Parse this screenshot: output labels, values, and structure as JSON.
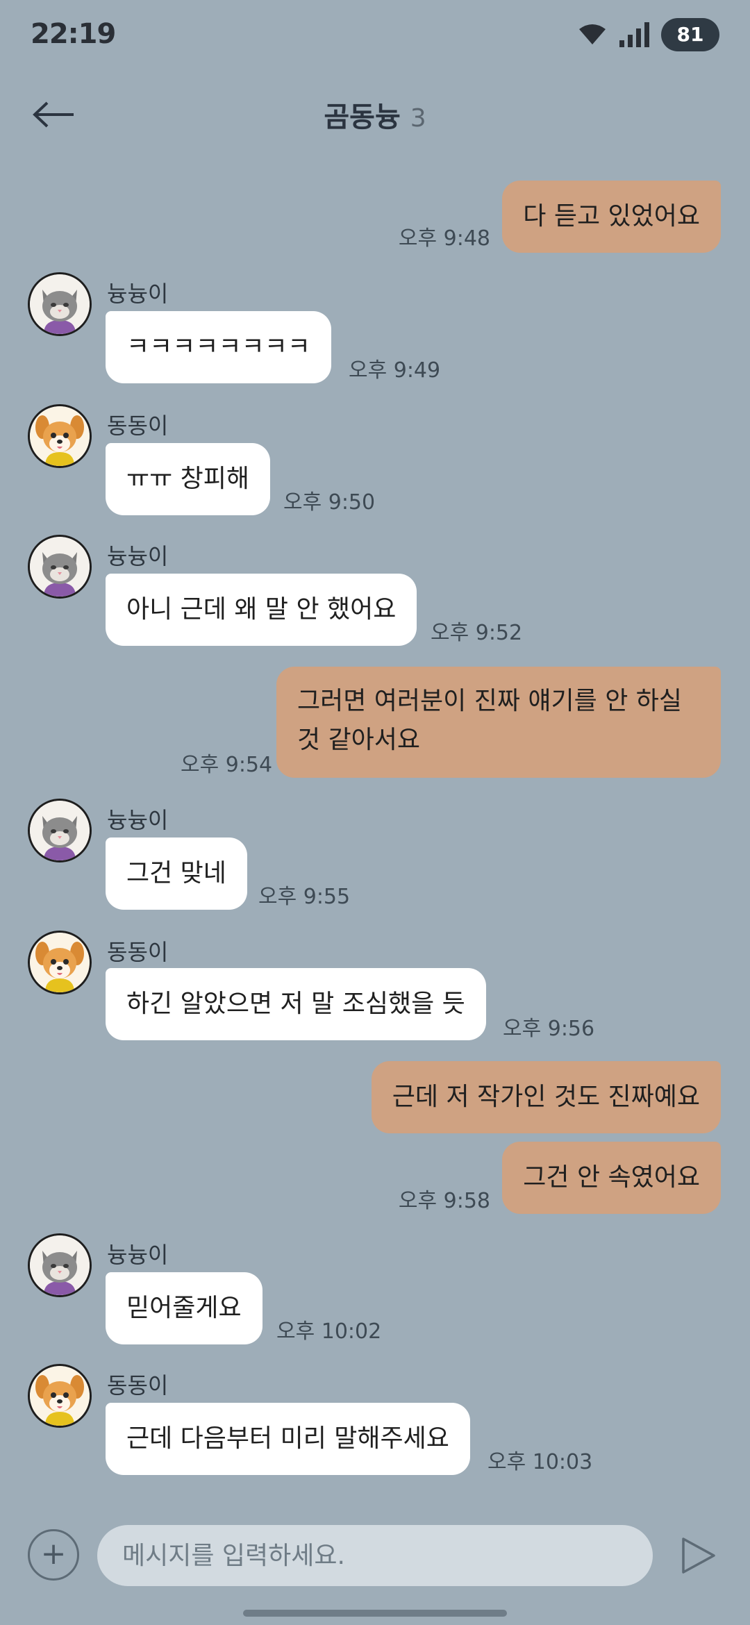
{
  "status": {
    "time": "22:19",
    "battery": "81"
  },
  "header": {
    "title": "곰동늉",
    "member_count": "3"
  },
  "messages": [
    {
      "type": "out",
      "text": "다 듣고 있었어요",
      "time": "오후 9:48"
    },
    {
      "type": "in",
      "sender": "늉늉이",
      "avatar": "cat",
      "text": "ㅋㅋㅋㅋㅋㅋㅋㅋ",
      "time": "오후 9:49"
    },
    {
      "type": "in",
      "sender": "동동이",
      "avatar": "dog",
      "text": "ㅠㅠ 창피해",
      "time": "오후 9:50"
    },
    {
      "type": "in",
      "sender": "늉늉이",
      "avatar": "cat",
      "text": "아니 근데 왜 말 안 했어요",
      "time": "오후 9:52"
    },
    {
      "type": "out",
      "text": "그러면 여러분이 진짜 얘기를 안 하실 것 같아서요",
      "time": "오후 9:54"
    },
    {
      "type": "in",
      "sender": "늉늉이",
      "avatar": "cat",
      "text": "그건 맞네",
      "time": "오후 9:55"
    },
    {
      "type": "in",
      "sender": "동동이",
      "avatar": "dog",
      "text": "하긴 알았으면 저 말 조심했을 듯",
      "time": "오후 9:56"
    },
    {
      "type": "out",
      "text": "근데 저 작가인 것도 진짜예요",
      "time": ""
    },
    {
      "type": "out",
      "text": "그건 안 속였어요",
      "time": "오후 9:58"
    },
    {
      "type": "in",
      "sender": "늉늉이",
      "avatar": "cat",
      "text": "믿어줄게요",
      "time": "오후 10:02"
    },
    {
      "type": "in",
      "sender": "동동이",
      "avatar": "dog",
      "text": "근데 다음부터 미리 말해주세요",
      "time": "오후 10:03"
    }
  ],
  "composer": {
    "placeholder": "메시지를 입력하세요."
  },
  "colors": {
    "background": "#9eadb8",
    "outgoing_bubble": "#cfa282",
    "incoming_bubble": "#ffffff"
  },
  "icons": {
    "back": "arrow-left-icon",
    "attach": "plus-icon",
    "send": "send-icon"
  }
}
